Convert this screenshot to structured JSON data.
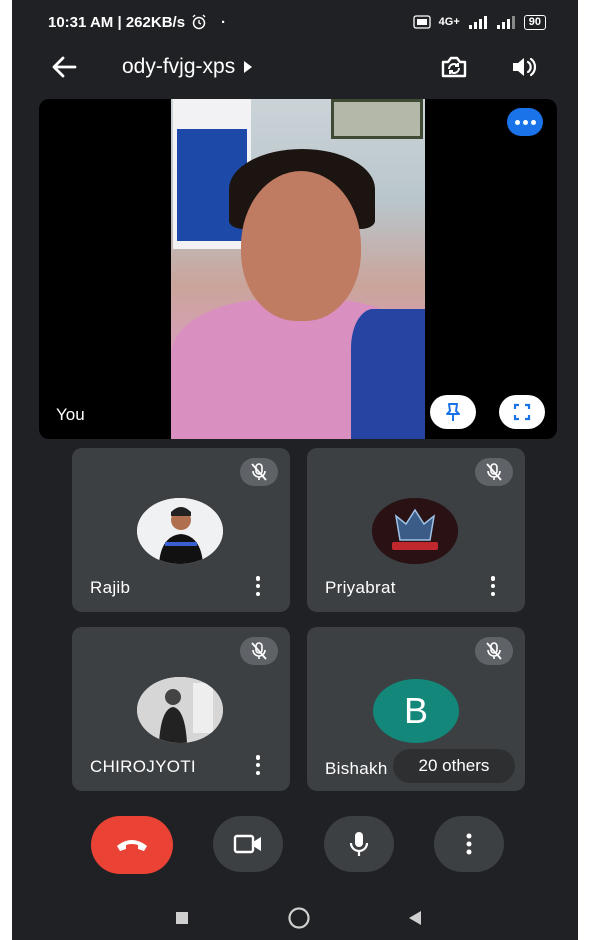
{
  "status_bar": {
    "time_speed": "10:31 AM | 262KB/s",
    "alarm_icon": "alarm-icon",
    "dot": "·",
    "network_label": "4G+",
    "battery": "90"
  },
  "app_bar": {
    "meeting_code": "ody-fvjg-xps",
    "back_icon": "arrow-left-icon",
    "switch_camera_icon": "switch-camera-icon",
    "audio_icon": "speaker-icon"
  },
  "self_tile": {
    "label": "You"
  },
  "participants": [
    {
      "name": "Rajib"
    },
    {
      "name": "Priyabrat"
    },
    {
      "name": "CHIROJYOTI"
    },
    {
      "name": "Bishakh",
      "initial": "B"
    }
  ],
  "others": {
    "label": "20 others"
  },
  "colors": {
    "background": "#202124",
    "tile": "#3c4043",
    "end_call": "#ea4335",
    "accent": "#1a73e8",
    "avatar_b": "#12877a"
  }
}
